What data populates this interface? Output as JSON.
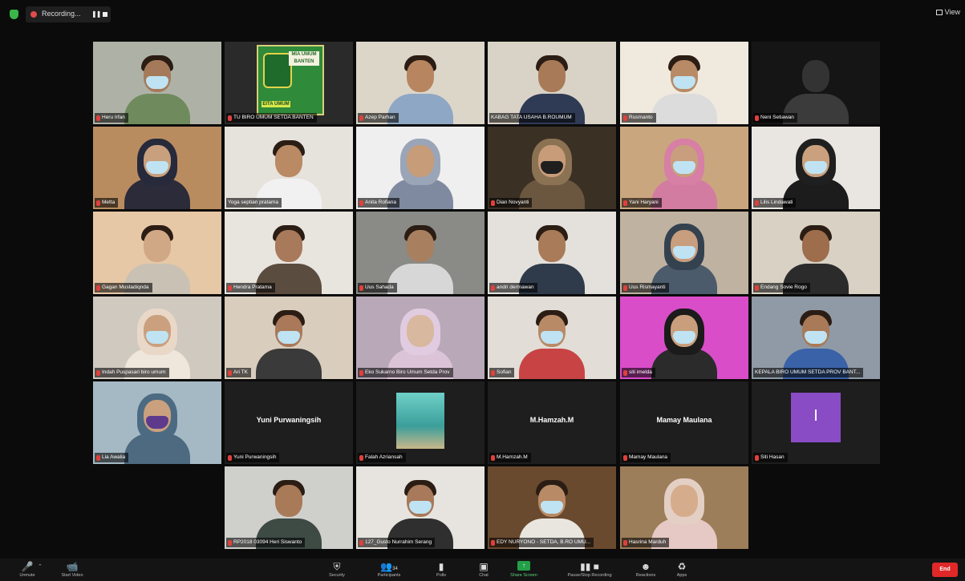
{
  "topbar": {
    "recording_label": "Recording...",
    "view_label": "View"
  },
  "participants": [
    {
      "name": "Heru Irfan",
      "mic_muted": true,
      "masked": true,
      "bg": "#aeb2a6",
      "shirt": "#6f8b5e",
      "hijab": false,
      "skin": "#a57a5a"
    },
    {
      "name": "TU BIRO UMUM SETDA BANTEN",
      "mic_muted": true,
      "type": "logo",
      "logo_text": [
        "MIA",
        "UMUM",
        "BANTEN",
        "EITA",
        "UMUM"
      ]
    },
    {
      "name": "Azep Parhan",
      "mic_muted": true,
      "masked": false,
      "bg": "#dcd6c9",
      "shirt": "#8ea7c4",
      "hijab": false,
      "skin": "#b7855f"
    },
    {
      "name": "KABAG TATA USAHA B.ROUMUM",
      "mic_muted": false,
      "masked": false,
      "bg": "#d9d2c6",
      "shirt": "#2f3a55",
      "hijab": false,
      "skin": "#a97a57"
    },
    {
      "name": "Rusmanto",
      "mic_muted": true,
      "masked": true,
      "bg": "#efe9de",
      "shirt": "#dcdcdc",
      "hijab": false,
      "skin": "#b88a66"
    },
    {
      "name": "Neni Setiawan",
      "mic_muted": true,
      "masked": false,
      "bg": "#151515",
      "shirt": "#3b3b3b",
      "hijab": false,
      "skin": "#333333",
      "dark": true
    },
    {
      "name": "Metta",
      "mic_muted": true,
      "masked": true,
      "bg": "#b98c60",
      "shirt": "#2b2b3a",
      "hijab": true,
      "hijab_color": "#262a3a",
      "skin": "#c9a07e"
    },
    {
      "name": "Yoga septian pratama",
      "mic_muted": false,
      "masked": false,
      "bg": "#e6e2dc",
      "shirt": "#f1f1f1",
      "hijab": false,
      "skin": "#b98a63"
    },
    {
      "name": "Anita Rofiana",
      "mic_muted": true,
      "masked": false,
      "bg": "#efefef",
      "shirt": "#7f8aa0",
      "hijab": true,
      "hijab_color": "#9aa5b8",
      "skin": "#c79c78"
    },
    {
      "name": "Dian Novyanti",
      "mic_muted": true,
      "masked": true,
      "bg": "#3a3024",
      "shirt": "#6b5740",
      "hijab": true,
      "hijab_color": "#8b7253",
      "skin": "#c89c78",
      "mask_color": "#1f1f1f"
    },
    {
      "name": "Yani Haryani",
      "mic_muted": true,
      "masked": true,
      "bg": "#caa67e",
      "shirt": "#d37ca1",
      "hijab": true,
      "hijab_color": "#d77fa4",
      "skin": "#c89e7e"
    },
    {
      "name": "Lilis Lindawati",
      "mic_muted": true,
      "masked": true,
      "bg": "#e9e6e2",
      "shirt": "#1c1c1c",
      "hijab": true,
      "hijab_color": "#1f1f1f",
      "skin": "#caa07e"
    },
    {
      "name": "Gagan Mustadiqnda",
      "mic_muted": true,
      "masked": false,
      "bg": "#e6c8a6",
      "shirt": "#c9c1b4",
      "hijab": false,
      "skin": "#d1a886"
    },
    {
      "name": "Hendra Pratama",
      "mic_muted": true,
      "masked": false,
      "bg": "#e8e4de",
      "shirt": "#5b4c40",
      "hijab": false,
      "skin": "#a8795a"
    },
    {
      "name": "Uus Sahada",
      "mic_muted": true,
      "masked": false,
      "bg": "#8a8a86",
      "shirt": "#d7d7d7",
      "hijab": false,
      "skin": "#a9805f"
    },
    {
      "name": "andri dermawan",
      "mic_muted": true,
      "masked": false,
      "bg": "#e4e1dc",
      "shirt": "#2f3b4a",
      "hijab": false,
      "skin": "#a97b58"
    },
    {
      "name": "Uus Rismayanti",
      "mic_muted": true,
      "masked": true,
      "bg": "#bfb2a0",
      "shirt": "#4b5b6b",
      "hijab": true,
      "hijab_color": "#344250",
      "skin": "#c89e7e"
    },
    {
      "name": "Endang Sovie Rogo",
      "mic_muted": true,
      "masked": false,
      "bg": "#d8d1c4",
      "shirt": "#2b2b2b",
      "hijab": false,
      "skin": "#9d6d4c"
    },
    {
      "name": "Indah Puspasari biro umum",
      "mic_muted": true,
      "masked": true,
      "bg": "#cfc9c0",
      "shirt": "#efe6dc",
      "hijab": true,
      "hijab_color": "#e9d8c8",
      "skin": "#caa07e"
    },
    {
      "name": "Ari TK",
      "mic_muted": true,
      "masked": true,
      "bg": "#d9cdbd",
      "shirt": "#3a3a3a",
      "hijab": false,
      "skin": "#a9795a"
    },
    {
      "name": "Eko Sukarno Biro Umum Setda Prov",
      "mic_muted": true,
      "masked": false,
      "bg": "#b9a9b8",
      "shirt": "#dcc4d8",
      "hijab": true,
      "hijab_color": "#e1cbe0",
      "skin": "#d8b89e"
    },
    {
      "name": "Sofian",
      "mic_muted": true,
      "masked": true,
      "bg": "#e2ddd6",
      "shirt": "#c84444",
      "hijab": false,
      "skin": "#b98a66"
    },
    {
      "name": "siti imelda",
      "mic_muted": true,
      "masked": true,
      "bg": "#d94dc9",
      "shirt": "#2b2b2b",
      "hijab": true,
      "hijab_color": "#1b1b1b",
      "skin": "#c99e7c"
    },
    {
      "name": "KEPALA BIRO UMUM SETDA PROV BANT...",
      "mic_muted": false,
      "masked": true,
      "bg": "#8f9aa6",
      "shirt": "#3a62a8",
      "hijab": false,
      "skin": "#a97a57",
      "active": true
    },
    {
      "name": "Lia Awalia",
      "mic_muted": true,
      "masked": true,
      "bg": "#a5b9c4",
      "shirt": "#4d6a80",
      "hijab": true,
      "hijab_color": "#4c6b82",
      "skin": "#caa07e",
      "mask_color": "#5d3a8c"
    },
    {
      "name": "Yuni Purwaningsih",
      "mic_muted": true,
      "type": "name",
      "display": "Yuni Purwaningsih"
    },
    {
      "name": "Falah Azriansah",
      "mic_muted": true,
      "type": "water"
    },
    {
      "name": "M.Hamzah.M",
      "mic_muted": true,
      "type": "name",
      "display": "M.Hamzah.M"
    },
    {
      "name": "Mamay Maulana",
      "mic_muted": true,
      "type": "name",
      "display": "Mamay Maulana"
    },
    {
      "name": "Siti Hasan",
      "mic_muted": true,
      "type": "initial",
      "initial": "I"
    },
    {
      "name": "RP2018 03094 Heri Siswanto",
      "mic_muted": true,
      "masked": false,
      "bg": "#cfd0cc",
      "shirt": "#3e4a44",
      "hijab": false,
      "skin": "#a97a57"
    },
    {
      "name": "127_Gusto Nurrahim Serang",
      "mic_muted": true,
      "masked": true,
      "bg": "#e7e4df",
      "shirt": "#2f2f2f",
      "hijab": false,
      "skin": "#a8795a"
    },
    {
      "name": "EDY NURYONO - SETDA, B.RO UMU...",
      "mic_muted": true,
      "masked": true,
      "bg": "#6a4a2e",
      "shirt": "#e9e6e0",
      "hijab": false,
      "skin": "#b98a66"
    },
    {
      "name": "Hasrina Marduh",
      "mic_muted": true,
      "masked": false,
      "bg": "#9c7e5a",
      "shirt": "#e6c9c4",
      "hijab": true,
      "hijab_color": "#e4cfc4",
      "skin": "#d6ad8c"
    }
  ],
  "toolbar": {
    "unmute": "Unmute",
    "start_video": "Start Video",
    "security": "Security",
    "participants": "Participants",
    "participants_count": "34",
    "polls": "Polls",
    "chat": "Chat",
    "share_screen": "Share Screen",
    "pause_recording": "Pause/Stop Recording",
    "reactions": "Reactions",
    "apps": "Apps",
    "end": "End"
  }
}
